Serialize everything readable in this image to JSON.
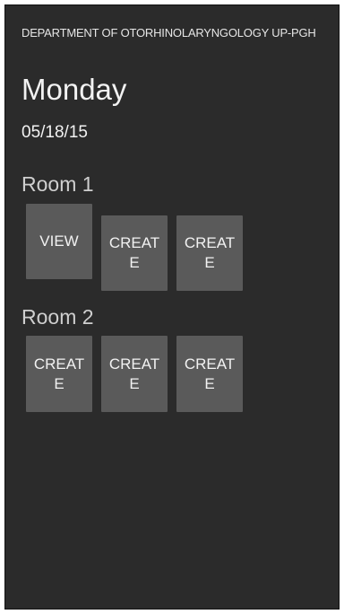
{
  "header": {
    "department": "DEPARTMENT OF OTORHINOLARYNGOLOGY UP-PGH",
    "day": "Monday",
    "date": "05/18/15"
  },
  "rooms": [
    {
      "title": "Room 1",
      "tiles": [
        "VIEW",
        "CREATE",
        "CREATE"
      ]
    },
    {
      "title": "Room 2",
      "tiles": [
        "CREATE",
        "CREATE",
        "CREATE"
      ]
    }
  ],
  "colors": {
    "background": "#2b2b2b",
    "tile": "#5a5a5a",
    "text": "#f2f2f2"
  }
}
